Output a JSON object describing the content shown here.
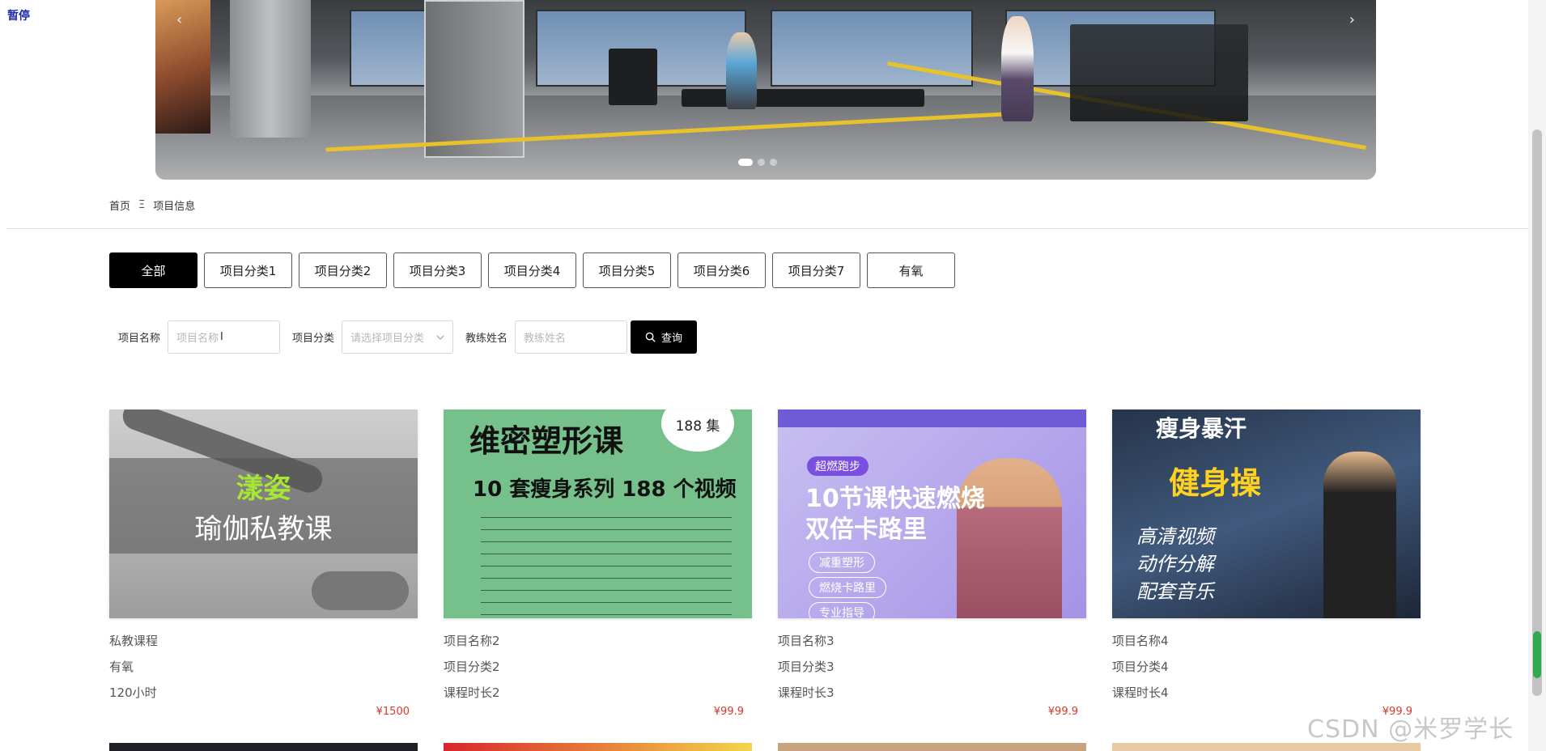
{
  "overlay": {
    "pause_label": "暂停"
  },
  "breadcrumb": {
    "home": "首页",
    "separator": "Ξ",
    "current": "项目信息"
  },
  "tabs": [
    "全部",
    "项目分类1",
    "项目分类2",
    "项目分类3",
    "项目分类4",
    "项目分类5",
    "项目分类6",
    "项目分类7",
    "有氧"
  ],
  "active_tab": "全部",
  "search": {
    "name_label": "项目名称",
    "name_placeholder": "项目名称",
    "category_label": "项目分类",
    "category_placeholder": "请选择项目分类",
    "coach_label": "教练姓名",
    "coach_placeholder": "教练姓名",
    "query_label": "查询"
  },
  "cards": [
    {
      "name": "私教课程",
      "category": "有氧",
      "duration": "120小时",
      "price": "¥1500",
      "thumb": {
        "brand": "漾姿",
        "title": "瑜伽私教课"
      }
    },
    {
      "name": "项目名称2",
      "category": "项目分类2",
      "duration": "课程时长2",
      "price": "¥99.9",
      "thumb": {
        "title": "维密塑形课",
        "bubble": "188 集",
        "subtitle": "10 套瘦身系列 188 个视频"
      }
    },
    {
      "name": "项目名称3",
      "category": "项目分类3",
      "duration": "课程时长3",
      "price": "¥99.9",
      "thumb": {
        "pill": "超燃跑步",
        "title_line1": "10节课快速燃烧",
        "title_line2": "双倍卡路里",
        "tag1": "减重塑形",
        "tag2": "燃烧卡路里",
        "tag3": "专业指导"
      }
    },
    {
      "name": "项目名称4",
      "category": "项目分类4",
      "duration": "课程时长4",
      "price": "¥99.9",
      "thumb": {
        "top": "瘦身暴汗",
        "title": "健身操",
        "line1": "高清视频",
        "line2": "动作分解",
        "line3": "配套音乐"
      }
    }
  ],
  "watermark": "CSDN @米罗学长",
  "colors": {
    "accent_price": "#d9382b",
    "active_tab_bg": "#000000",
    "search_button_bg": "#000000"
  }
}
